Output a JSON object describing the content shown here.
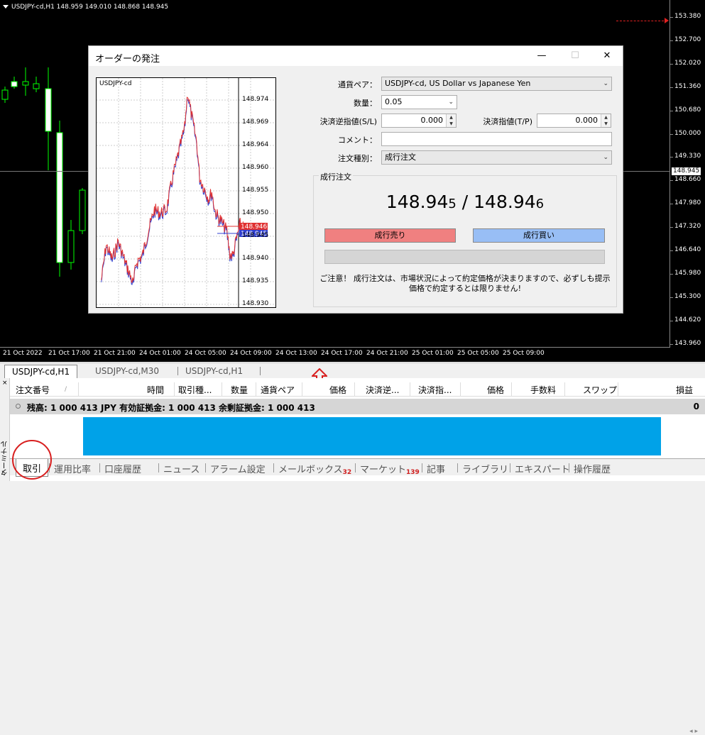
{
  "chart": {
    "header": "USDJPY-cd,H1  148.959 149.010 148.868 148.945",
    "y_labels": [
      "153.380",
      "152.700",
      "152.020",
      "151.360",
      "150.680",
      "150.000",
      "149.330",
      "148.660",
      "147.980",
      "147.320",
      "146.640",
      "145.980",
      "145.300",
      "144.620",
      "143.960"
    ],
    "current_price": "148.945",
    "x_labels": [
      "21 Oct 2022",
      "21 Oct 17:00",
      "21 Oct 21:00",
      "24 Oct 01:00",
      "24 Oct 05:00",
      "24 Oct 09:00",
      "24 Oct 13:00",
      "24 Oct 17:00",
      "24 Oct 21:00",
      "25 Oct 01:00",
      "25 Oct 05:00",
      "25 Oct 09:00"
    ],
    "colors": {
      "background": "#000000",
      "candle": "#00ff00",
      "bull_body": "#ffffff",
      "line": "#ff3030"
    }
  },
  "dialog": {
    "title": "オーダーの発注",
    "minimize": "—",
    "maximize": "☐",
    "close": "✕",
    "mini_chart": {
      "symbol": "USDJPY-cd",
      "y_labels": [
        "148.974",
        "148.969",
        "148.964",
        "148.960",
        "148.955",
        "148.950",
        "148.945",
        "148.940",
        "148.935",
        "148.930"
      ],
      "bid_tag": "148.946",
      "ask_tag": "148.945"
    },
    "form": {
      "pair_label": "通貨ペア：",
      "pair_value": "USDJPY-cd, US Dollar vs Japanese Yen",
      "volume_label": "数量：",
      "volume_value": "0.05",
      "sl_label": "決済逆指値(S/L)",
      "sl_value": "0.000",
      "tp_label": "決済指値(T/P)",
      "tp_value": "0.000",
      "comment_label": "コメント：",
      "comment_value": "",
      "type_label": "注文種別：",
      "type_value": "成行注文"
    },
    "market": {
      "group_label": "成行注文",
      "bid_main": "148.94",
      "bid_last": "5",
      "separator": " / ",
      "ask_main": "148.94",
      "ask_last": "6",
      "sell_label": "成行売り",
      "buy_label": "成行買い",
      "notice_line1": "ご注意！ 成行注文は、市場状況によって約定価格が決まりますので、必ずしも提示",
      "notice_line2": "価格で約定するとは限りません!"
    }
  },
  "chart_tabs": [
    "USDJPY-cd,H1",
    "USDJPY-cd,M30",
    "USDJPY-cd,H1"
  ],
  "terminal": {
    "side_label": "ターミナル",
    "close": "×",
    "columns": [
      "注文番号",
      "/",
      "時間",
      "取引種...",
      "数量",
      "通貨ペア",
      "価格",
      "決済逆...",
      "決済指...",
      "価格",
      "手数料",
      "スワップ",
      "損益"
    ],
    "balance_text": "残高: 1 000 413 JPY  有効証拠金: 1 000 413  余剰証拠金: 1 000 413",
    "balance_profit": "0",
    "tabs": [
      {
        "label": "取引",
        "badge": ""
      },
      {
        "label": "運用比率",
        "badge": ""
      },
      {
        "label": "口座履歴",
        "badge": ""
      },
      {
        "label": "ニュース",
        "badge": ""
      },
      {
        "label": "アラーム設定",
        "badge": ""
      },
      {
        "label": "メールボックス",
        "badge": "32"
      },
      {
        "label": "マーケット",
        "badge": "139"
      },
      {
        "label": "記事",
        "badge": ""
      },
      {
        "label": "ライブラリ",
        "badge": ""
      },
      {
        "label": "エキスパート",
        "badge": ""
      },
      {
        "label": "操作履歴",
        "badge": ""
      }
    ],
    "highlight_color": "#00a2e8"
  }
}
